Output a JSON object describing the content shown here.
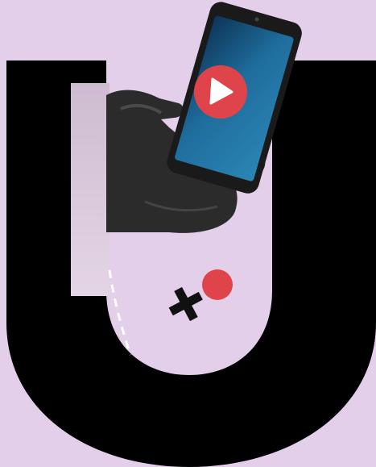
{
  "colors": {
    "background": "#e3cfea",
    "letter": "#000000",
    "accent_red": "#e0444b",
    "plus_sign": "#111111",
    "texture_panel": "#d8c8d8",
    "screen_blue": "#1f6d9d",
    "dash_line": "#ffffff"
  },
  "icons": {
    "play_icon": "play-icon",
    "plus_icon": "plus-icon"
  }
}
